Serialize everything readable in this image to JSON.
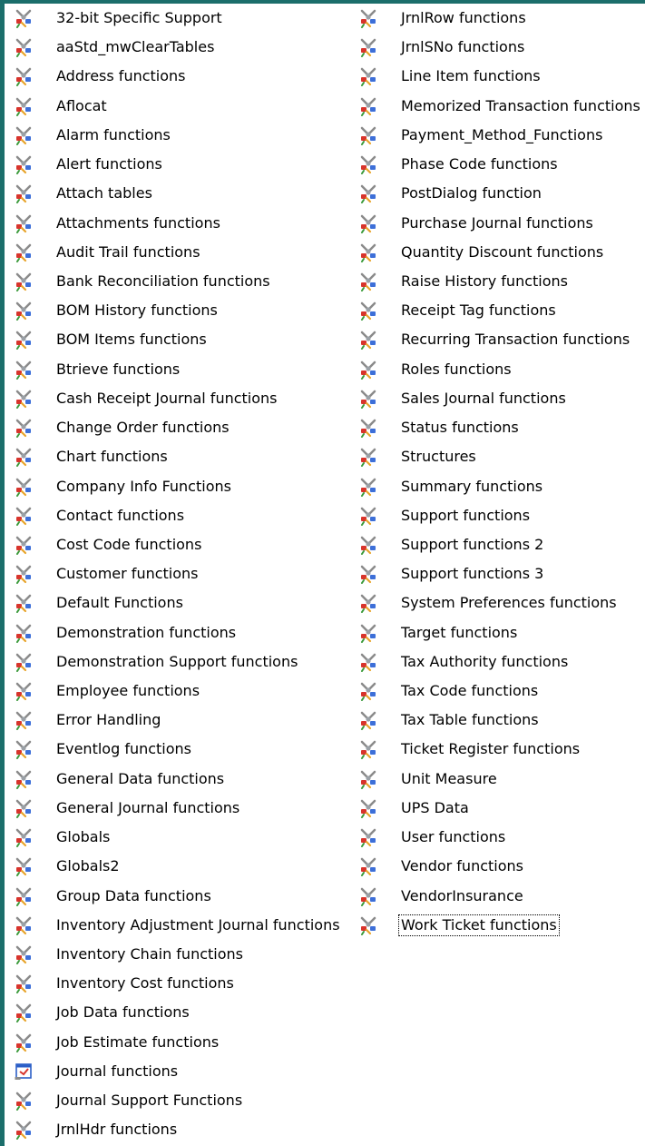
{
  "left_items": [
    {
      "label": "32-bit Specific Support",
      "icon": "module-icon"
    },
    {
      "label": "aaStd_mwClearTables",
      "icon": "module-icon"
    },
    {
      "label": "Address functions",
      "icon": "module-icon"
    },
    {
      "label": "Aflocat",
      "icon": "module-icon"
    },
    {
      "label": "Alarm functions",
      "icon": "module-icon"
    },
    {
      "label": "Alert functions",
      "icon": "module-icon"
    },
    {
      "label": "Attach tables",
      "icon": "module-icon"
    },
    {
      "label": "Attachments functions",
      "icon": "module-icon"
    },
    {
      "label": "Audit Trail functions",
      "icon": "module-icon"
    },
    {
      "label": "Bank Reconciliation functions",
      "icon": "module-icon"
    },
    {
      "label": "BOM History functions",
      "icon": "module-icon"
    },
    {
      "label": "BOM Items functions",
      "icon": "module-icon"
    },
    {
      "label": "Btrieve functions",
      "icon": "module-icon"
    },
    {
      "label": "Cash Receipt Journal functions",
      "icon": "module-icon"
    },
    {
      "label": "Change Order functions",
      "icon": "module-icon"
    },
    {
      "label": "Chart functions",
      "icon": "module-icon"
    },
    {
      "label": "Company Info Functions",
      "icon": "module-icon"
    },
    {
      "label": "Contact functions",
      "icon": "module-icon"
    },
    {
      "label": "Cost Code functions",
      "icon": "module-icon"
    },
    {
      "label": "Customer functions",
      "icon": "module-icon"
    },
    {
      "label": "Default Functions",
      "icon": "module-icon"
    },
    {
      "label": "Demonstration functions",
      "icon": "module-icon"
    },
    {
      "label": "Demonstration Support functions",
      "icon": "module-icon"
    },
    {
      "label": "Employee functions",
      "icon": "module-icon"
    },
    {
      "label": "Error Handling",
      "icon": "module-icon"
    },
    {
      "label": "Eventlog functions",
      "icon": "module-icon"
    },
    {
      "label": "General Data functions",
      "icon": "module-icon"
    },
    {
      "label": "General Journal functions",
      "icon": "module-icon"
    },
    {
      "label": "Globals",
      "icon": "module-icon"
    },
    {
      "label": "Globals2",
      "icon": "module-icon"
    },
    {
      "label": "Group Data functions",
      "icon": "module-icon"
    },
    {
      "label": "Inventory Adjustment Journal functions",
      "icon": "module-icon"
    },
    {
      "label": "Inventory Chain functions",
      "icon": "module-icon"
    },
    {
      "label": "Inventory Cost functions",
      "icon": "module-icon"
    },
    {
      "label": "Job Data functions",
      "icon": "module-icon"
    },
    {
      "label": "Job Estimate functions",
      "icon": "module-icon"
    },
    {
      "label": "Journal functions",
      "icon": "form-icon"
    },
    {
      "label": "Journal Support Functions",
      "icon": "module-icon"
    },
    {
      "label": "JrnlHdr functions",
      "icon": "module-icon"
    }
  ],
  "right_items": [
    {
      "label": "JrnlRow functions",
      "icon": "module-icon"
    },
    {
      "label": "JrnlSNo functions",
      "icon": "module-icon"
    },
    {
      "label": "Line Item functions",
      "icon": "module-icon"
    },
    {
      "label": "Memorized Transaction functions",
      "icon": "module-icon"
    },
    {
      "label": "Payment_Method_Functions",
      "icon": "module-icon"
    },
    {
      "label": "Phase Code functions",
      "icon": "module-icon"
    },
    {
      "label": "PostDialog function",
      "icon": "module-icon"
    },
    {
      "label": "Purchase Journal functions",
      "icon": "module-icon"
    },
    {
      "label": "Quantity Discount functions",
      "icon": "module-icon"
    },
    {
      "label": "Raise History functions",
      "icon": "module-icon"
    },
    {
      "label": "Receipt Tag functions",
      "icon": "module-icon"
    },
    {
      "label": "Recurring Transaction functions",
      "icon": "module-icon"
    },
    {
      "label": "Roles functions",
      "icon": "module-icon"
    },
    {
      "label": "Sales Journal functions",
      "icon": "module-icon"
    },
    {
      "label": "Status functions",
      "icon": "module-icon"
    },
    {
      "label": "Structures",
      "icon": "module-icon"
    },
    {
      "label": "Summary functions",
      "icon": "module-icon"
    },
    {
      "label": "Support functions",
      "icon": "module-icon"
    },
    {
      "label": "Support functions 2",
      "icon": "module-icon"
    },
    {
      "label": "Support functions 3",
      "icon": "module-icon"
    },
    {
      "label": "System Preferences functions",
      "icon": "module-icon"
    },
    {
      "label": "Target functions",
      "icon": "module-icon"
    },
    {
      "label": "Tax Authority functions",
      "icon": "module-icon"
    },
    {
      "label": "Tax Code functions",
      "icon": "module-icon"
    },
    {
      "label": "Tax Table functions",
      "icon": "module-icon"
    },
    {
      "label": "Ticket Register functions",
      "icon": "module-icon"
    },
    {
      "label": "Unit Measure",
      "icon": "module-icon"
    },
    {
      "label": "UPS Data",
      "icon": "module-icon"
    },
    {
      "label": "User functions",
      "icon": "module-icon"
    },
    {
      "label": "Vendor functions",
      "icon": "module-icon"
    },
    {
      "label": "VendorInsurance",
      "icon": "module-icon"
    },
    {
      "label": "Work Ticket functions",
      "icon": "module-icon",
      "focused": true
    }
  ],
  "colors": {
    "background_frame": "#1b6e6b",
    "list_background": "#ffffff",
    "text": "#000000"
  }
}
